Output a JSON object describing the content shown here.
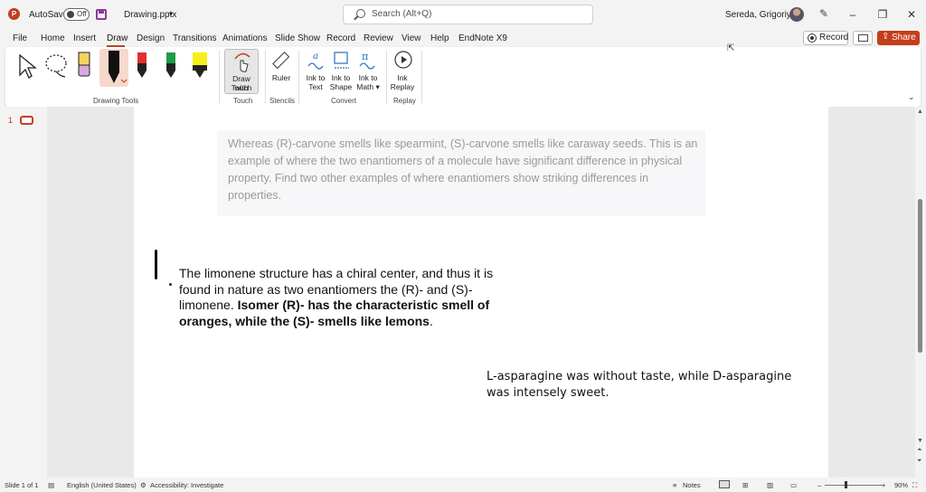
{
  "titlebar": {
    "app_icon": "powerpoint-icon",
    "autosave_label": "AutoSave",
    "autosave_state": "Off",
    "filename": "Drawing.pptx",
    "search_placeholder": "Search (Alt+Q)",
    "user_name": "Sereda, Grigoriy A",
    "window_buttons": [
      "–",
      "❐",
      "✕"
    ]
  },
  "menu": {
    "tabs": [
      "File",
      "Home",
      "Insert",
      "Draw",
      "Design",
      "Transitions",
      "Animations",
      "Slide Show",
      "Record",
      "Review",
      "View",
      "Help",
      "EndNote X9"
    ],
    "active_tab": "Draw",
    "record_label": "Record",
    "share_label": "Share"
  },
  "ribbon": {
    "groups": {
      "drawing_tools": "Drawing Tools",
      "touch": "Touch",
      "stencils": "Stencils",
      "convert": "Convert",
      "replay": "Replay"
    },
    "buttons": {
      "draw_with_touch_1": "Draw with",
      "draw_with_touch_2": "Touch",
      "ruler": "Ruler",
      "ink_to_text_1": "Ink to",
      "ink_to_text_2": "Text",
      "ink_to_shape_1": "Ink to",
      "ink_to_shape_2": "Shape",
      "ink_to_math_1": "Ink to",
      "ink_to_math_2": "Math ▾",
      "ink_replay_1": "Ink",
      "ink_replay_2": "Replay"
    }
  },
  "thumbnails": {
    "slide_number": "1"
  },
  "slide": {
    "quote": "Whereas (R)-carvone smells like spearmint, (S)-carvone smells like caraway seeds. This is an example of where the two enantiomers of a molecule have significant difference in physical property. Find two other examples of where enantiomers show striking differences in properties.",
    "body_plain": "The limonene structure has a chiral center, and thus it is found in nature as two enantiomers the (R)- and (S)-limonene. ",
    "body_bold": "Isomer (R)- has the characteristic smell of oranges, while the (S)- smells like lemons",
    "body_end": ".",
    "asparagine": "L-asparagine was without taste, while D-asparagine was intensely sweet."
  },
  "statusbar": {
    "slide_info": "Slide 1 of 1",
    "language": "English (United States)",
    "accessibility": "Accessibility: Investigate",
    "notes": "Notes",
    "zoom": "90%"
  },
  "colors": {
    "accent": "#c43e1c",
    "ribbon_bg": "#ffffff",
    "chrome_bg": "#f3f3f3"
  }
}
